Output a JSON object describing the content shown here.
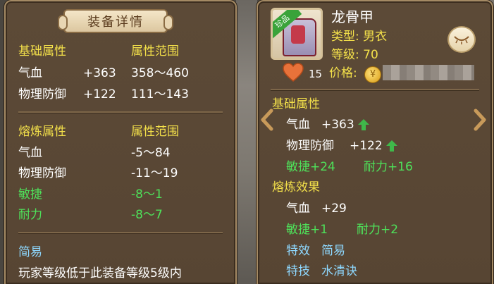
{
  "left": {
    "title": "装备详情",
    "basic_header": "基础属性",
    "range_header": "属性范围",
    "basic_rows": [
      {
        "name": "气血",
        "value": "+363",
        "range": "358～460"
      },
      {
        "name": "物理防御",
        "value": "+122",
        "range": "111～143"
      }
    ],
    "refine_header": "熔炼属性",
    "refine_range_header": "属性范围",
    "refine_rows": [
      {
        "name": "气血",
        "range": "-5～84"
      },
      {
        "name": "物理防御",
        "range": "-11～19"
      },
      {
        "name": "敏捷",
        "range": "-8～1"
      },
      {
        "name": "耐力",
        "range": "-8～7"
      }
    ],
    "mode_label": "简易",
    "note": "玩家等级低于此装备等级5级内"
  },
  "right": {
    "item_name": "龙骨甲",
    "bind_tag": "珍品",
    "type_line": "类型: 男衣",
    "level_line": "等级: 70",
    "like_count": "15",
    "price_label": "价格:",
    "basic_header": "基础属性",
    "basic_rows": [
      {
        "name": "气血",
        "value": "+363"
      },
      {
        "name": "物理防御",
        "value": "+122"
      }
    ],
    "bonus_1": "敏捷+24",
    "bonus_2": "耐力+16",
    "refine_header": "熔炼效果",
    "refine_row_name": "气血",
    "refine_row_value": "+29",
    "refine_bonus_1": "敏捷+1",
    "refine_bonus_2": "耐力+2",
    "effect_label": "特效",
    "effect_value": "简易",
    "skill_label": "特技",
    "skill_value": "水清诀"
  },
  "colors": {
    "panel_bg": "#5a4835",
    "yellow_text": "#f3e04a",
    "green_text": "#4ee25a",
    "cyan_text": "#8ed8ff",
    "heart": "#e8723a",
    "up_arrow": "#3fb84a"
  },
  "icons": {
    "heart": "heart-icon",
    "coin": "coin-icon",
    "eye": "eye-closed-icon",
    "left_nav": "chevron-left-icon",
    "right_nav": "chevron-right-icon",
    "up": "arrow-up-icon"
  }
}
